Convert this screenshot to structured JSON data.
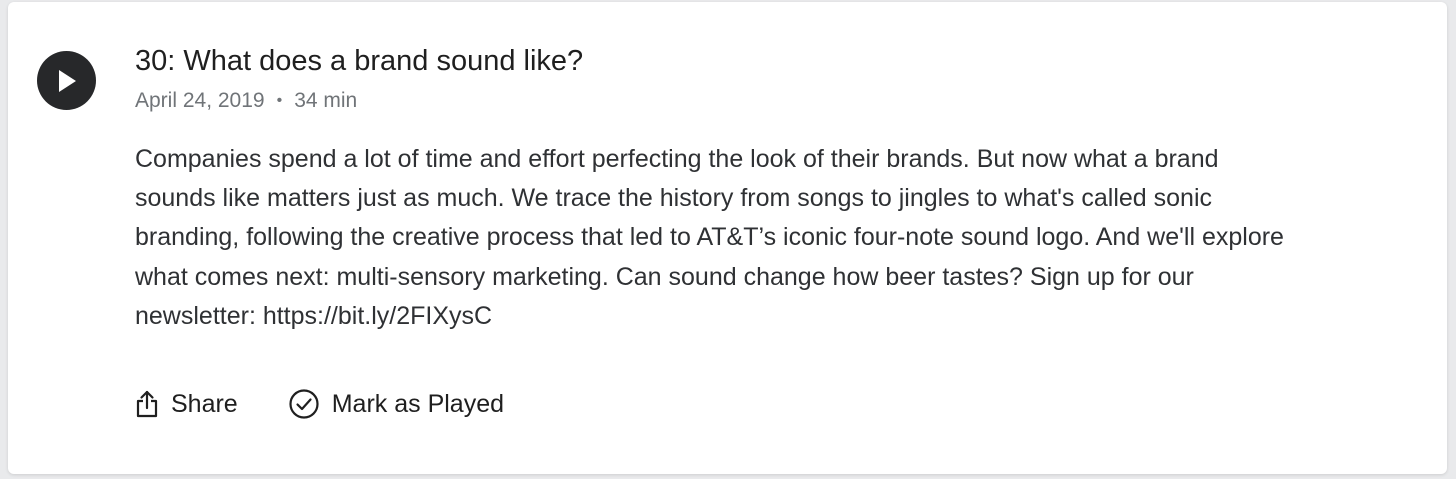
{
  "episode": {
    "title": "30: What does a brand sound like?",
    "date": "April 24, 2019",
    "separator": "•",
    "duration": "34 min",
    "description": "Companies spend a lot of time and effort perfecting the look of their brands. But now what a brand sounds like matters just as much. We trace the history from songs to jingles to what's called sonic branding, following the creative process that led to AT&T’s iconic four-note sound logo. And we'll explore what comes next: multi-sensory marketing. Can sound change how beer tastes? Sign up for our newsletter: https://bit.ly/2FIXysC"
  },
  "actions": {
    "share_label": "Share",
    "share_icon": "share-icon",
    "mark_played_label": "Mark as Played",
    "mark_played_icon": "check-circle-icon"
  },
  "colors": {
    "play_button": "#27282a",
    "title": "#1f1f1f",
    "meta": "#707478",
    "body": "#2f3134"
  }
}
